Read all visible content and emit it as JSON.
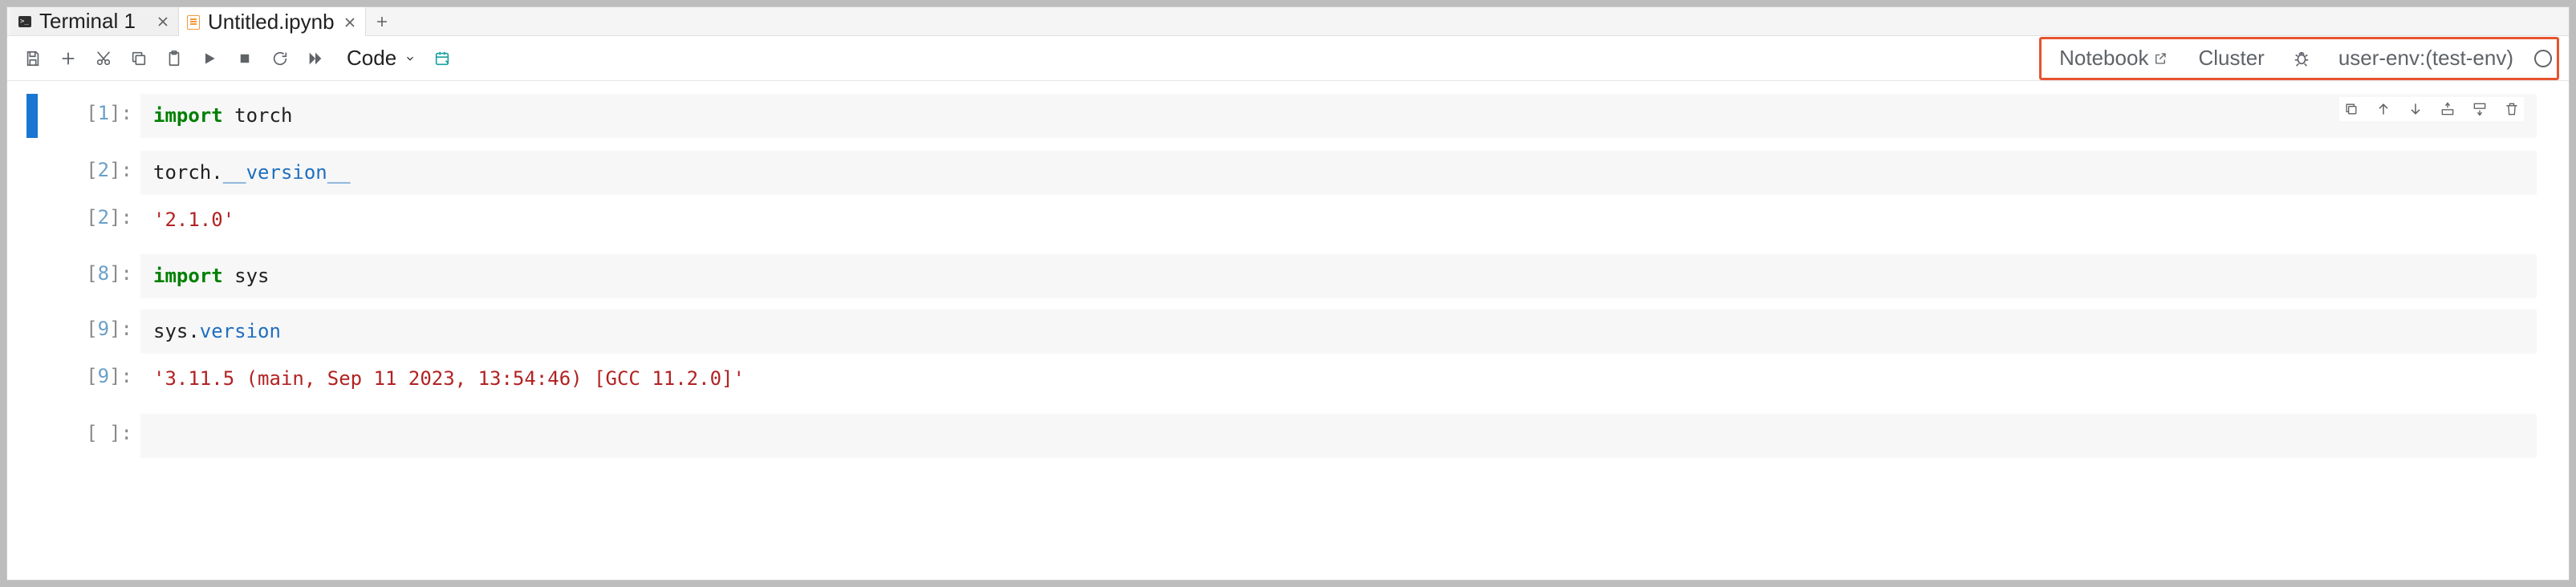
{
  "tabs": [
    {
      "title": "Terminal 1",
      "icon": "terminal-icon",
      "active": false
    },
    {
      "title": "Untitled.ipynb",
      "icon": "notebook-file-icon",
      "active": true
    }
  ],
  "toolbar": {
    "cell_type_label": "Code"
  },
  "right_status": {
    "notebook_label": "Notebook",
    "cluster_label": "Cluster",
    "kernel_label": "user-env:(test-env)"
  },
  "cells": [
    {
      "kind": "code",
      "exec": "1",
      "selected": true,
      "tokens": [
        {
          "t": "import",
          "c": "kw"
        },
        {
          "t": " torch",
          "c": ""
        }
      ]
    },
    {
      "kind": "code",
      "exec": "2",
      "tokens": [
        {
          "t": "torch.",
          "c": ""
        },
        {
          "t": "__version__",
          "c": "attr"
        }
      ]
    },
    {
      "kind": "output",
      "exec": "2",
      "text": "'2.1.0'"
    },
    {
      "kind": "code",
      "exec": "8",
      "tokens": [
        {
          "t": "import",
          "c": "kw"
        },
        {
          "t": " sys",
          "c": ""
        }
      ]
    },
    {
      "kind": "code",
      "exec": "9",
      "tokens": [
        {
          "t": "sys.",
          "c": ""
        },
        {
          "t": "version",
          "c": "attr"
        }
      ]
    },
    {
      "kind": "output",
      "exec": "9",
      "text": "'3.11.5 (main, Sep 11 2023, 13:54:46) [GCC 11.2.0]'"
    },
    {
      "kind": "code",
      "exec": "",
      "tokens": []
    }
  ]
}
